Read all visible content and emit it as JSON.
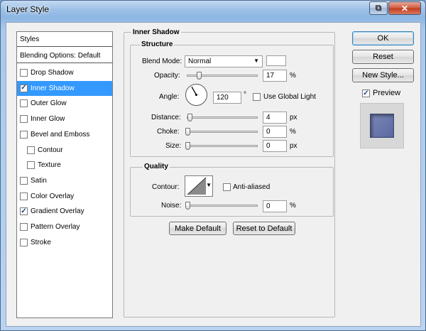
{
  "window": {
    "title": "Layer Style",
    "restore_glyph": "⧉",
    "close_glyph": "✕"
  },
  "style_list": {
    "header": "Styles",
    "blending": "Blending Options: Default",
    "items": [
      {
        "label": "Drop Shadow",
        "checked": false,
        "selected": false,
        "indent": false
      },
      {
        "label": "Inner Shadow",
        "checked": true,
        "selected": true,
        "indent": false
      },
      {
        "label": "Outer Glow",
        "checked": false,
        "selected": false,
        "indent": false
      },
      {
        "label": "Inner Glow",
        "checked": false,
        "selected": false,
        "indent": false
      },
      {
        "label": "Bevel and Emboss",
        "checked": false,
        "selected": false,
        "indent": false
      },
      {
        "label": "Contour",
        "checked": false,
        "selected": false,
        "indent": true
      },
      {
        "label": "Texture",
        "checked": false,
        "selected": false,
        "indent": true
      },
      {
        "label": "Satin",
        "checked": false,
        "selected": false,
        "indent": false
      },
      {
        "label": "Color Overlay",
        "checked": false,
        "selected": false,
        "indent": false
      },
      {
        "label": "Gradient Overlay",
        "checked": true,
        "selected": false,
        "indent": false
      },
      {
        "label": "Pattern Overlay",
        "checked": false,
        "selected": false,
        "indent": false
      },
      {
        "label": "Stroke",
        "checked": false,
        "selected": false,
        "indent": false
      }
    ]
  },
  "inner_shadow": {
    "section_title": "Inner Shadow",
    "structure_title": "Structure",
    "blend_mode_label": "Blend Mode:",
    "blend_mode_value": "Normal",
    "blend_color": "#ffffff",
    "opacity_label": "Opacity:",
    "opacity_value": "17",
    "opacity_unit": "%",
    "opacity_fraction": 0.17,
    "angle_label": "Angle:",
    "angle_value": "120",
    "angle_unit": "°",
    "use_global_light_label": "Use Global Light",
    "use_global_light": false,
    "distance_label": "Distance:",
    "distance_value": "4",
    "distance_unit": "px",
    "choke_label": "Choke:",
    "choke_value": "0",
    "choke_unit": "%",
    "size_label": "Size:",
    "size_value": "0",
    "size_unit": "px"
  },
  "quality": {
    "title": "Quality",
    "contour_label": "Contour:",
    "anti_aliased_label": "Anti-aliased",
    "anti_aliased": false,
    "noise_label": "Noise:",
    "noise_value": "0",
    "noise_unit": "%"
  },
  "buttons": {
    "make_default": "Make Default",
    "reset_to_default": "Reset to Default",
    "ok": "OK",
    "reset": "Reset",
    "new_style": "New Style...",
    "preview_label": "Preview",
    "preview_checked": true
  },
  "colors": {
    "selection": "#3399ff",
    "preview_swatch": "#5a6aa0"
  }
}
